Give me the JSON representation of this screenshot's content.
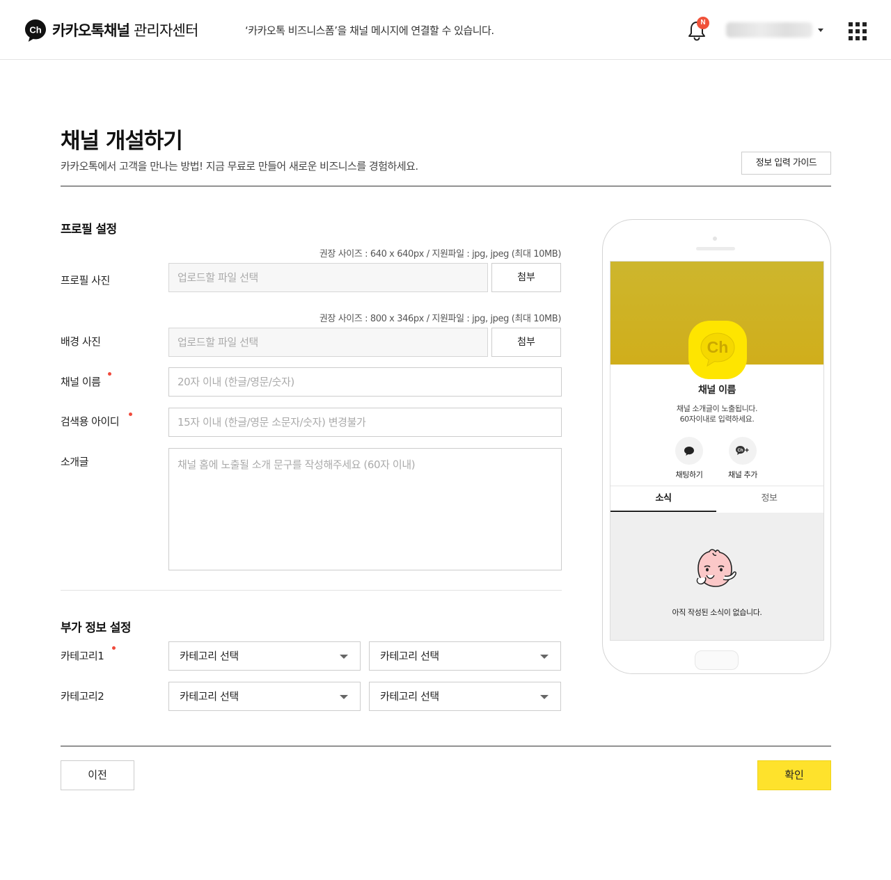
{
  "header": {
    "logo_bold": "카카오톡채널",
    "logo_regular": " 관리자센터",
    "notice": "‘카카오톡 비즈니스폼’을 채널 메시지에 연결할 수 있습니다.",
    "notification_badge": "N"
  },
  "page": {
    "title": "채널 개설하기",
    "description": "카카오톡에서 고객을 만나는 방법! 지금 무료로 만들어 새로운 비즈니스를 경험하세요.",
    "guide_button": "정보 입력 가이드"
  },
  "profile_section": {
    "title": "프로필 설정",
    "profile_photo": {
      "label": "프로필 사진",
      "hint": "권장 사이즈 : 640 x 640px / 지원파일 : jpg, jpeg (최대 10MB)",
      "placeholder": "업로드할 파일 선택",
      "button": "첨부"
    },
    "background_photo": {
      "label": "배경 사진",
      "hint": "권장 사이즈 : 800 x 346px / 지원파일 : jpg, jpeg (최대 10MB)",
      "placeholder": "업로드할 파일 선택",
      "button": "첨부"
    },
    "channel_name": {
      "label": "채널 이름",
      "placeholder": "20자 이내 (한글/영문/숫자)",
      "required": true
    },
    "search_id": {
      "label": "검색용 아이디",
      "placeholder": "15자 이내 (한글/영문 소문자/숫자) 변경불가",
      "required": true
    },
    "intro": {
      "label": "소개글",
      "placeholder": "채널 홈에 노출될 소개 문구를 작성해주세요 (60자 이내)"
    }
  },
  "extra_section": {
    "title": "부가 정보 설정",
    "category1": {
      "label": "카테고리1",
      "required": true,
      "select_a": "카테고리 선택",
      "select_b": "카테고리 선택"
    },
    "category2": {
      "label": "카테고리2",
      "select_a": "카테고리 선택",
      "select_b": "카테고리 선택"
    }
  },
  "footer": {
    "prev_button": "이전",
    "confirm_button": "확인"
  },
  "preview": {
    "avatar_text": "Ch",
    "channel_name": "채널 이름",
    "channel_intro": "채널 소개글이 노출됩니다.\n60자이내로 입력하세요.",
    "chat_label": "채팅하기",
    "add_label": "채널 추가",
    "add_icon_text": "Ch",
    "tab_news": "소식",
    "tab_info": "정보",
    "empty_text": "아직 작성된 소식이 없습니다."
  },
  "colors": {
    "brand_yellow": "#fee22c",
    "cover_gold": "#cfb222",
    "required_dot": "#f04a3c",
    "notification_red": "#f0523a"
  }
}
